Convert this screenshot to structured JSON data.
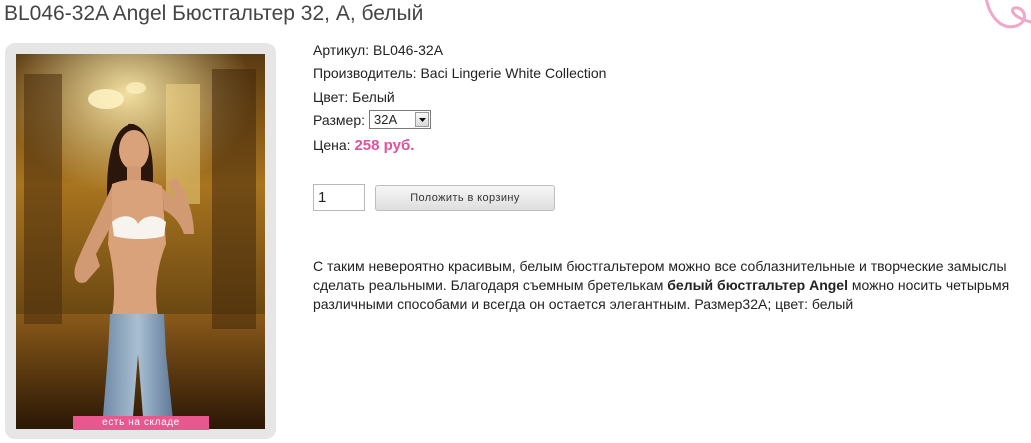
{
  "product": {
    "title": "BL046-32A Angel Бюстгальтер 32, A, белый",
    "stock_badge": "есть на складе"
  },
  "details": {
    "sku_label": "Артикул: ",
    "sku_value": "BL046-32A",
    "manufacturer_label": "Производитель: ",
    "manufacturer_value": "Baci Lingerie White Collection",
    "color_label": "Цвет: ",
    "color_value": "Белый",
    "size_label": "Размер:",
    "size_selected": "32A",
    "price_label": "Цена: ",
    "price_value": "258 руб."
  },
  "cart": {
    "quantity": "1",
    "add_button_label": "Положить в корзину"
  },
  "description": {
    "line1": "С таким невероятно красивым, белым бюстгальтером можно все соблазнительные и творческие замыслы",
    "line2_start": "сделать реальными. Благодаря съемным бретелькам ",
    "line2_bold": "белый бюстгальтер Angel",
    "line2_end": " можно носить четырьмя",
    "line3": "различными способами и всегда он остается элегантным. Размер32A; цвет: белый"
  },
  "colors": {
    "accent_pink": "#e0529a",
    "badge_pink": "#e8588f",
    "title_gray": "#444444",
    "frame_gray": "#e6e6e6"
  },
  "icons": {
    "dropdown": "chevron-down-icon",
    "corner_decoration": "pink-swirl-icon"
  }
}
